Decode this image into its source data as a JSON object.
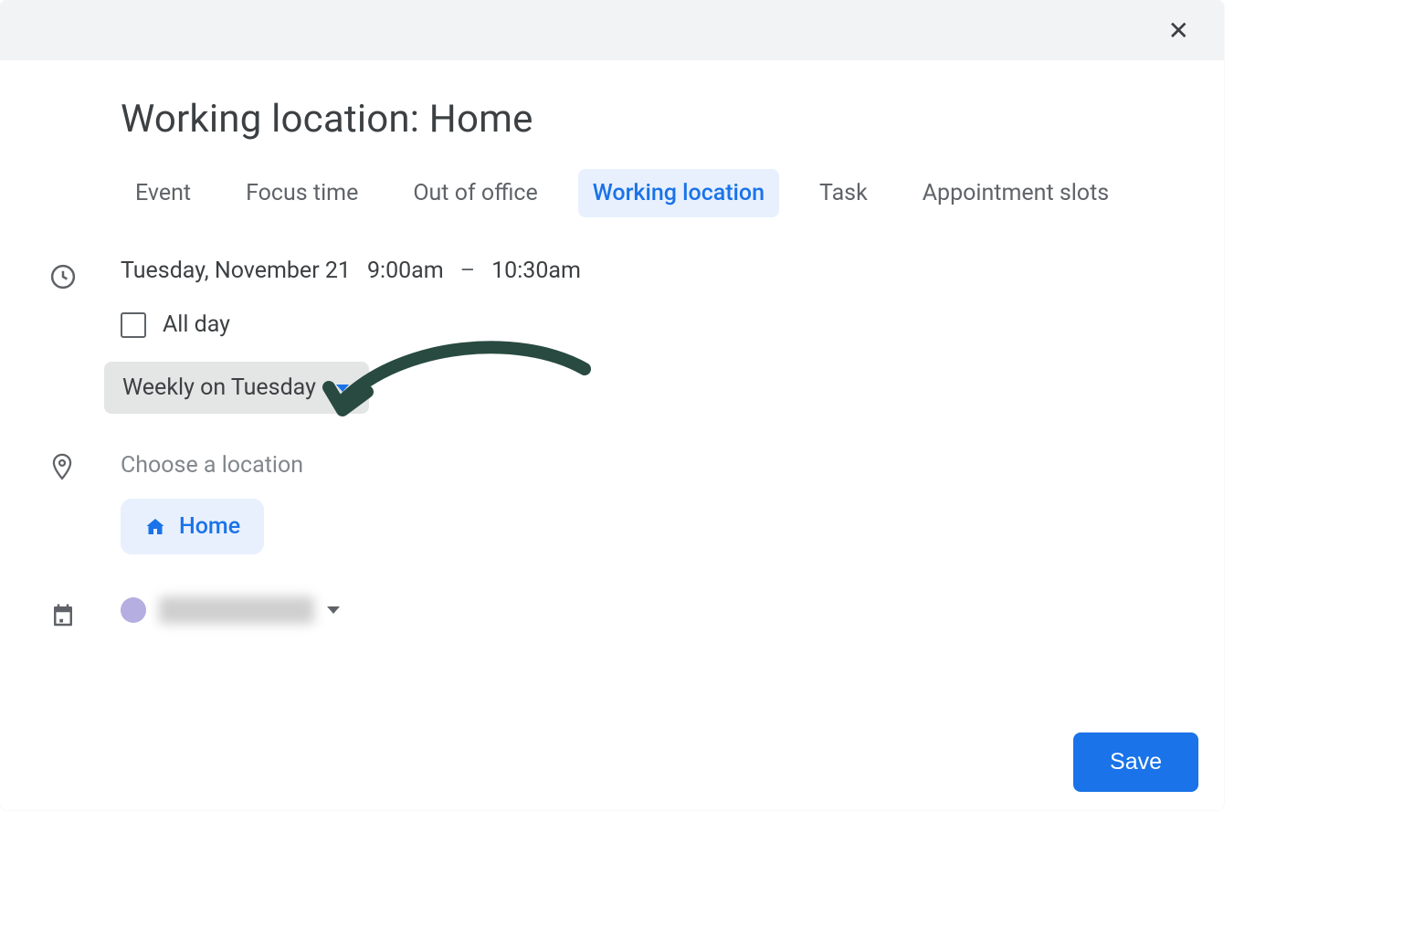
{
  "title": "Working location: Home",
  "tabs": {
    "event": "Event",
    "focus_time": "Focus time",
    "out_of_office": "Out of office",
    "working_location": "Working location",
    "task": "Task",
    "appointment_slots": "Appointment slots",
    "active": "working_location"
  },
  "time": {
    "date": "Tuesday, November 21",
    "start": "9:00am",
    "separator": "–",
    "end": "10:30am",
    "all_day_label": "All day",
    "all_day_checked": false
  },
  "recurrence": {
    "selected": "Weekly on Tuesday"
  },
  "location": {
    "prompt": "Choose a location",
    "chip_label": "Home"
  },
  "calendar": {
    "color": "#b5aee0",
    "name_obscured": true
  },
  "annotation": {
    "arrow_target": "recurrence-dropdown",
    "arrow_color": "#284a41"
  },
  "actions": {
    "save": "Save"
  }
}
